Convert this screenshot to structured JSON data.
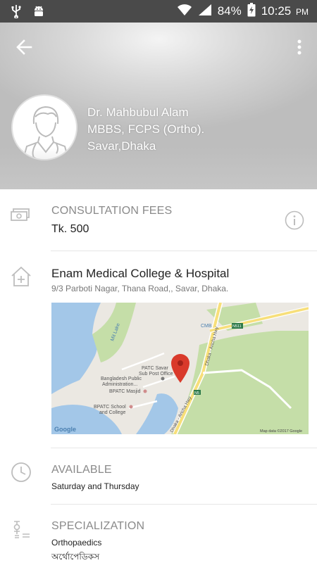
{
  "status_bar": {
    "battery": "84%",
    "time": "10:25",
    "ampm": "PM"
  },
  "doctor": {
    "name": "Dr. Mahbubul Alam",
    "degrees": "MBBS, FCPS (Ortho).",
    "location": "Savar,Dhaka"
  },
  "fees": {
    "title": "CONSULTATION FEES",
    "value": "Tk. 500"
  },
  "hospital": {
    "name": "Enam Medical College & Hospital",
    "address": "9/3 Parboti Nagar, Thana Road,, Savar, Dhaka."
  },
  "map": {
    "labels": {
      "lake": "Mit Lake",
      "cmb": "CMB",
      "road_n": "N511",
      "patc": "PATC Savar\nSub Post Office",
      "bpa": "Bangladesh Public\nAdministration...",
      "masjid": "BPATC Masjid",
      "school": "BPATC School\nand College",
      "hwy1": "Dhaka - Aricha Hwy",
      "hwy2": "Dhaka - Aricha Hwy",
      "n5": "N5",
      "google": "Google",
      "credit": "Map data ©2017 Google"
    }
  },
  "availability": {
    "title": "AVAILABLE",
    "value": "Saturday and Thursday"
  },
  "specialization": {
    "title": "SPECIALIZATION",
    "value": "Orthopaedics",
    "value_bn": "অর্থোপেডিকস"
  }
}
